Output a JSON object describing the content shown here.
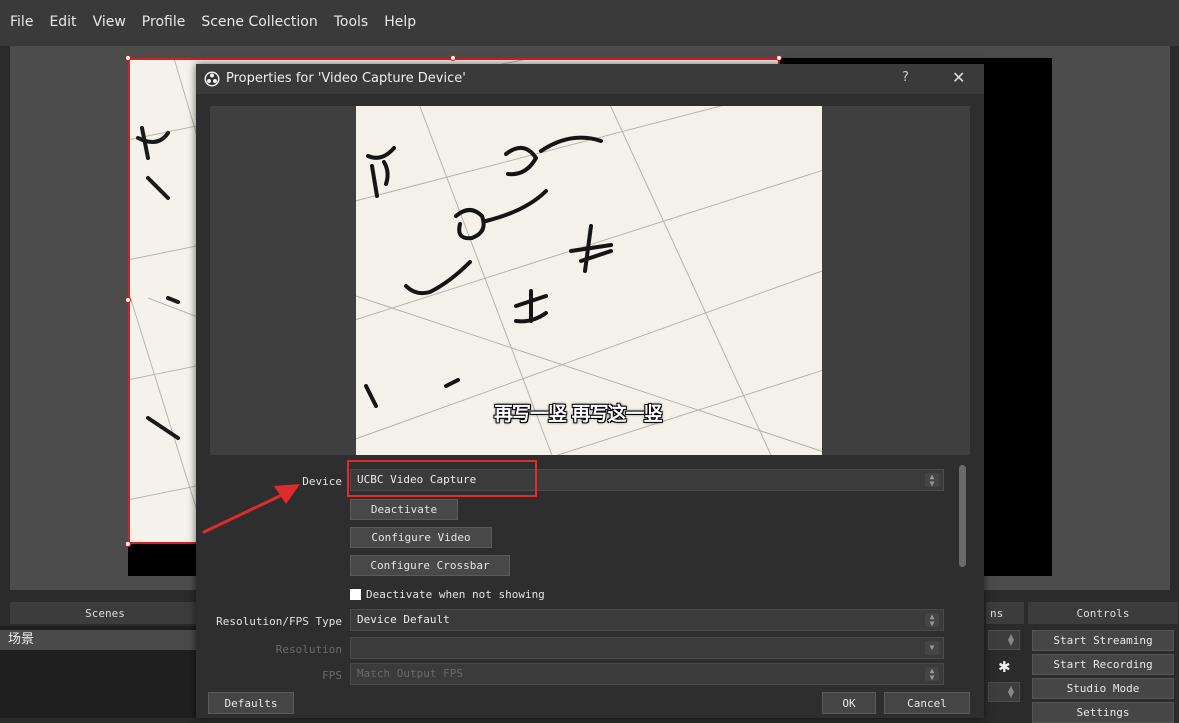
{
  "menu": [
    "File",
    "Edit",
    "View",
    "Profile",
    "Scene Collection",
    "Tools",
    "Help"
  ],
  "docks": {
    "scenes_title": "Scenes",
    "scenes": [
      "场景"
    ],
    "partial_title": "ns",
    "controls_title": "Controls",
    "controls": [
      "Start Streaming",
      "Start Recording",
      "Studio Mode",
      "Settings"
    ]
  },
  "dialog": {
    "title": "Properties for 'Video Capture Device'",
    "help": "?",
    "close": "✕",
    "subtitle": "再写一竖 再写这一竖",
    "device_label": "Device",
    "device_value": "UCBC Video Capture",
    "deactivate": "Deactivate",
    "configure_video": "Configure Video",
    "configure_crossbar": "Configure Crossbar",
    "deactivate_when_hidden": "Deactivate when not showing",
    "resfps_label": "Resolution/FPS Type",
    "resfps_value": "Device Default",
    "resolution_label": "Resolution",
    "resolution_value": "",
    "fps_label": "FPS",
    "fps_value": "Match Output FPS",
    "defaults": "Defaults",
    "ok": "OK",
    "cancel": "Cancel"
  },
  "colors": {
    "highlight": "#e02b2b",
    "selection": "#d42020",
    "background": "#2b2b2b",
    "dialog": "#2e2e2e"
  }
}
